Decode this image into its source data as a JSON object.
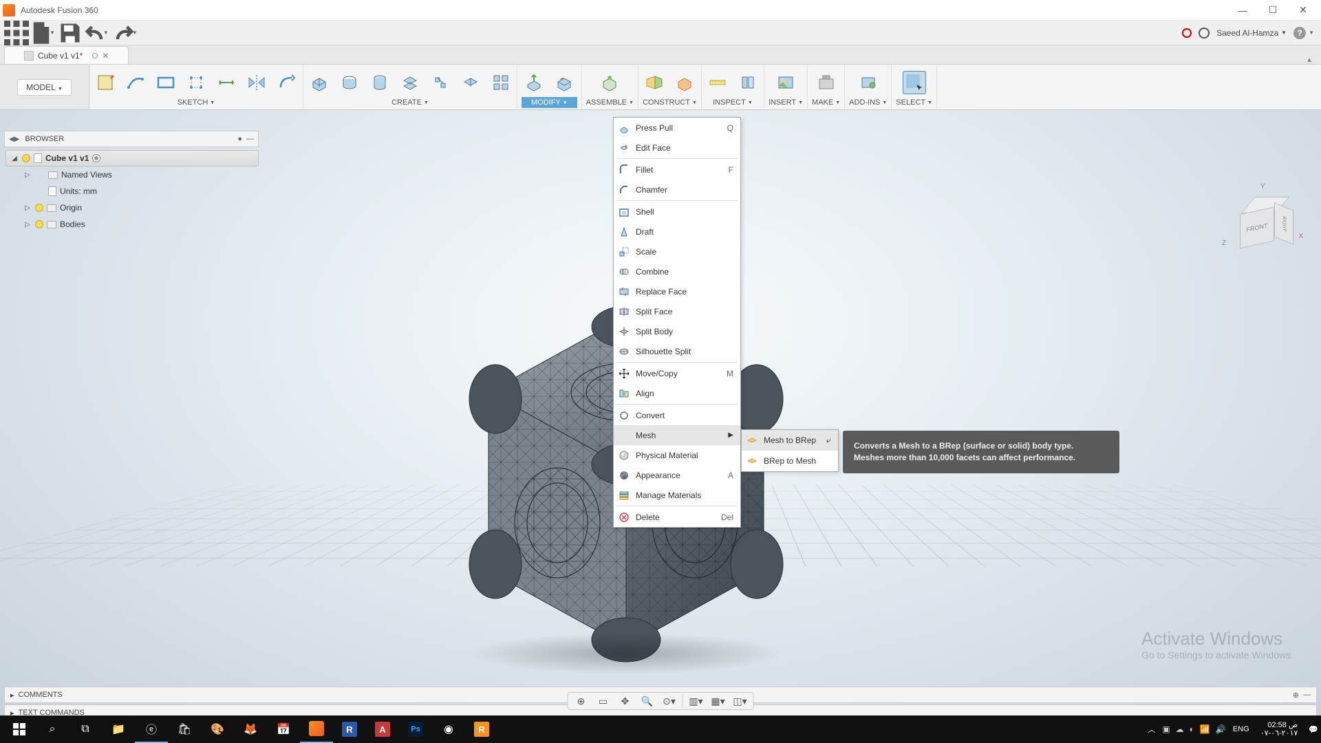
{
  "app": {
    "title": "Autodesk Fusion 360"
  },
  "quick": {
    "user": "Saeed Al-Hamza"
  },
  "doctab": {
    "name": "Cube v1 v1*"
  },
  "ribbon_groups": {
    "model": "MODEL",
    "sketch": "SKETCH",
    "create": "CREATE",
    "modify": "MODIFY",
    "assemble": "ASSEMBLE",
    "construct": "CONSTRUCT",
    "inspect": "INSPECT",
    "insert": "INSERT",
    "make": "MAKE",
    "addins": "ADD-INS",
    "select": "SELECT"
  },
  "browser": {
    "title": "BROWSER",
    "root": "Cube v1 v1",
    "items": [
      {
        "label": "Named Views",
        "expandable": true,
        "bulb": false
      },
      {
        "label": "Units: mm",
        "expandable": false,
        "bulb": false
      },
      {
        "label": "Origin",
        "expandable": true,
        "bulb": true
      },
      {
        "label": "Bodies",
        "expandable": true,
        "bulb": true
      }
    ]
  },
  "modify_menu": [
    {
      "label": "Press Pull",
      "shortcut": "Q",
      "icon": "presspull"
    },
    {
      "label": "Edit Face",
      "icon": "editface"
    },
    {
      "sep": true
    },
    {
      "label": "Fillet",
      "shortcut": "F",
      "icon": "fillet"
    },
    {
      "label": "Chamfer",
      "icon": "chamfer"
    },
    {
      "sep": true
    },
    {
      "label": "Shell",
      "icon": "shell"
    },
    {
      "label": "Draft",
      "icon": "draft"
    },
    {
      "label": "Scale",
      "icon": "scale"
    },
    {
      "label": "Combine",
      "icon": "combine"
    },
    {
      "label": "Replace Face",
      "icon": "replaceface"
    },
    {
      "label": "Split Face",
      "icon": "splitface"
    },
    {
      "label": "Split Body",
      "icon": "splitbody"
    },
    {
      "label": "Silhouette Split",
      "icon": "silhouette"
    },
    {
      "sep": true
    },
    {
      "label": "Move/Copy",
      "shortcut": "M",
      "icon": "move"
    },
    {
      "label": "Align",
      "icon": "align"
    },
    {
      "sep": true
    },
    {
      "label": "Convert",
      "icon": "convert"
    },
    {
      "label": "Mesh",
      "submenu": true,
      "highlighted": true
    },
    {
      "label": "Physical Material",
      "icon": "physmat"
    },
    {
      "label": "Appearance",
      "shortcut": "A",
      "icon": "appearance"
    },
    {
      "label": "Manage Materials",
      "icon": "manage"
    },
    {
      "sep": true
    },
    {
      "label": "Delete",
      "shortcut": "Del",
      "icon": "delete"
    }
  ],
  "mesh_submenu": [
    {
      "label": "Mesh to BRep",
      "highlighted": true,
      "kb": "⤶"
    },
    {
      "label": "BRep to Mesh"
    }
  ],
  "tooltip": {
    "line1": "Converts a Mesh to a BRep (surface or solid) body type.",
    "line2": "Meshes more than 10,000 facets can affect performance."
  },
  "viewcube": {
    "front": "FRONT",
    "right": "RIGHT",
    "y": "Y",
    "x": "X",
    "z": "Z"
  },
  "comments": {
    "label": "COMMENTS"
  },
  "textcmd": {
    "label": "TEXT COMMANDS"
  },
  "watermark": {
    "l1": "Activate Windows",
    "l2": "Go to Settings to activate Windows."
  },
  "taskbar": {
    "lang": "ENG",
    "time": "02:58 ص",
    "date": "٢٠١٧-٠٦-٠٧"
  }
}
